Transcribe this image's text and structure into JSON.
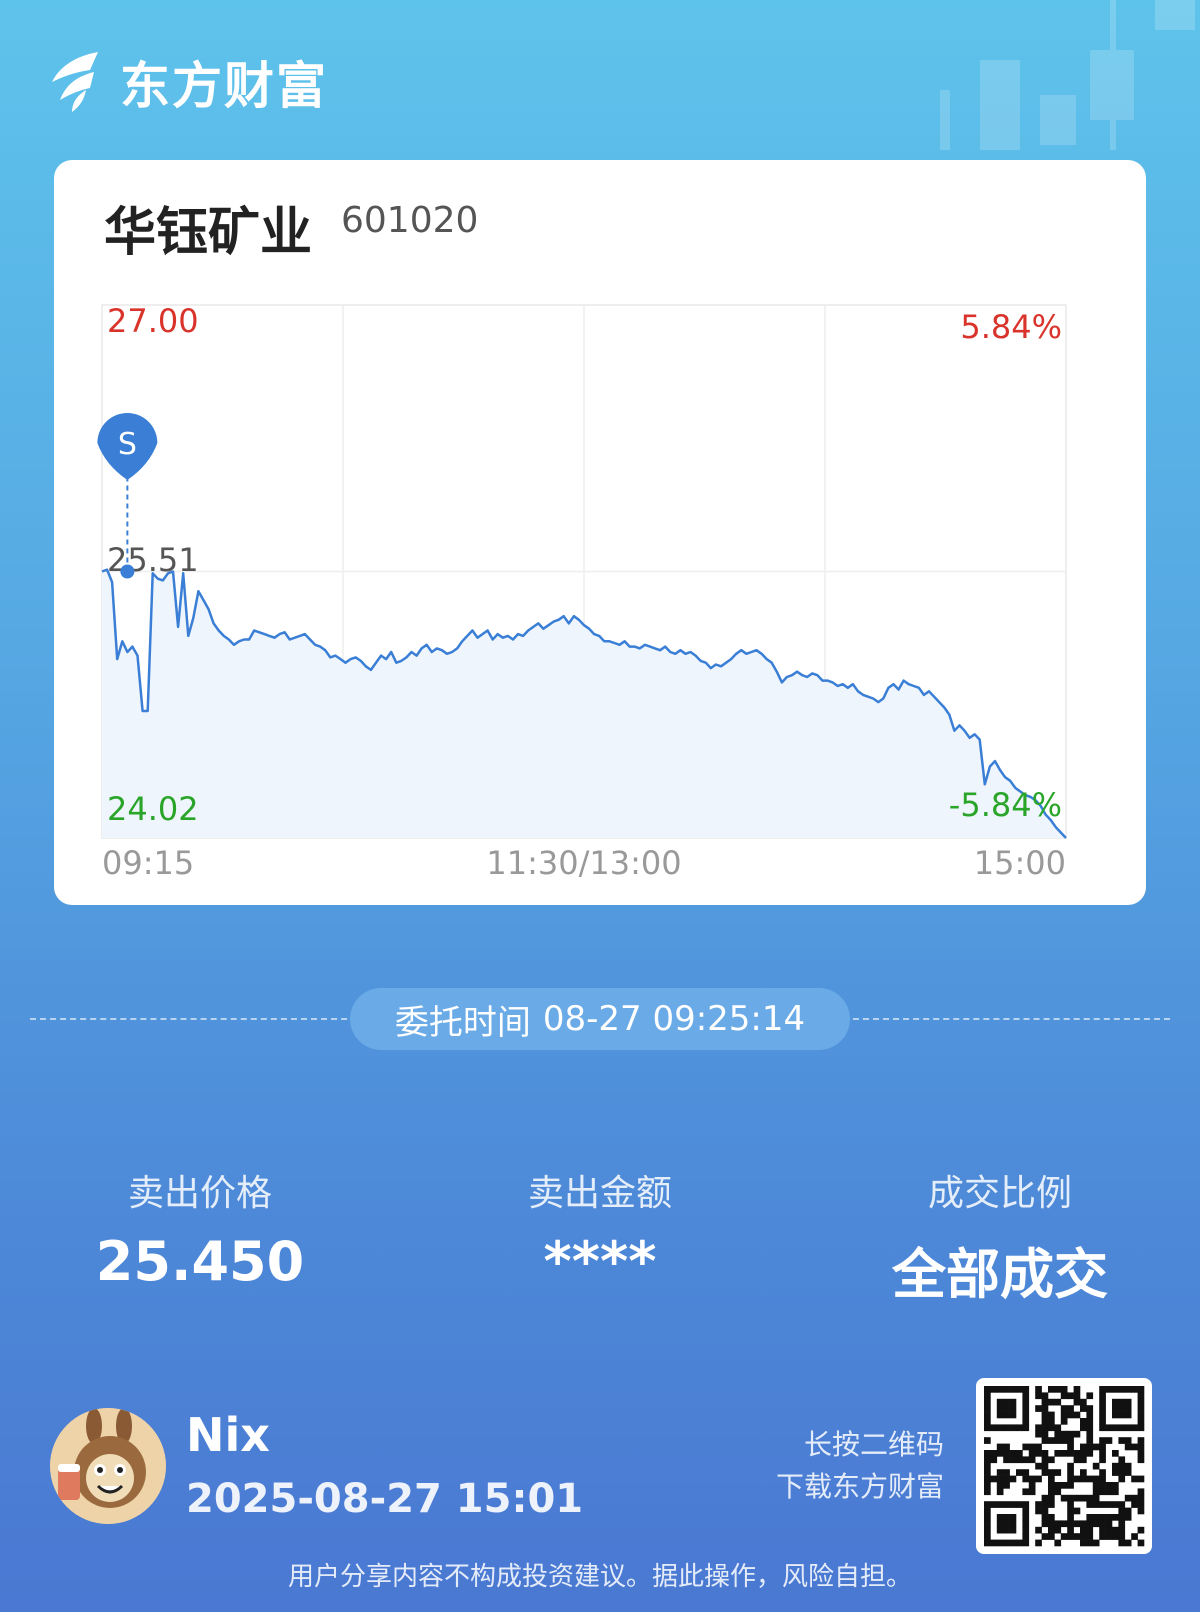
{
  "brand": {
    "name": "东方财富",
    "logo_icon": "eastmoney-logo-icon"
  },
  "stock": {
    "name": "华钰矿业",
    "code": "601020"
  },
  "chart_data": {
    "type": "line",
    "y_max_label": "27.00",
    "y_mid_label": "25.51",
    "y_min_label": "24.02",
    "pct_max_label": "5.84%",
    "pct_min_label": "-5.84%",
    "x_labels": [
      "09:15",
      "11:30/13:00",
      "15:00"
    ],
    "ylim": [
      24.02,
      27.0
    ],
    "reference_price": 25.51,
    "marker": {
      "label": "S",
      "x_index": 5,
      "price": 25.51
    },
    "colors": {
      "line": "#3a7fd5",
      "up": "#d9342b",
      "down": "#2aa52a",
      "fill": "#eef5fd"
    },
    "values": [
      25.51,
      25.52,
      25.45,
      25.02,
      25.12,
      25.06,
      25.09,
      25.04,
      24.73,
      24.73,
      25.5,
      25.47,
      25.46,
      25.5,
      25.51,
      25.2,
      25.5,
      25.15,
      25.25,
      25.4,
      25.35,
      25.3,
      25.22,
      25.18,
      25.15,
      25.13,
      25.1,
      25.12,
      25.13,
      25.13,
      25.18,
      25.17,
      25.16,
      25.15,
      25.14,
      25.16,
      25.17,
      25.13,
      25.14,
      25.15,
      25.16,
      25.13,
      25.1,
      25.09,
      25.07,
      25.03,
      25.04,
      25.02,
      25.0,
      25.02,
      25.03,
      25.01,
      24.98,
      24.96,
      25.0,
      25.04,
      25.02,
      25.06,
      25.0,
      25.01,
      25.03,
      25.06,
      25.04,
      25.08,
      25.1,
      25.06,
      25.08,
      25.07,
      25.05,
      25.06,
      25.08,
      25.12,
      25.15,
      25.18,
      25.14,
      25.16,
      25.18,
      25.13,
      25.16,
      25.14,
      25.15,
      25.13,
      25.16,
      25.15,
      25.18,
      25.2,
      25.22,
      25.19,
      25.21,
      25.23,
      25.24,
      25.26,
      25.22,
      25.26,
      25.24,
      25.21,
      25.19,
      25.16,
      25.15,
      25.12,
      25.12,
      25.11,
      25.1,
      25.12,
      25.09,
      25.09,
      25.08,
      25.1,
      25.09,
      25.08,
      25.07,
      25.09,
      25.06,
      25.05,
      25.07,
      25.05,
      25.06,
      25.04,
      25.01,
      25.0,
      24.97,
      24.99,
      24.98,
      25.0,
      25.02,
      25.05,
      25.07,
      25.05,
      25.06,
      25.07,
      25.05,
      25.02,
      25.0,
      24.95,
      24.89,
      24.92,
      24.93,
      24.95,
      24.93,
      24.92,
      24.94,
      24.93,
      24.9,
      24.9,
      24.89,
      24.87,
      24.88,
      24.86,
      24.88,
      24.84,
      24.82,
      24.81,
      24.8,
      24.78,
      24.8,
      24.86,
      24.88,
      24.85,
      24.9,
      24.88,
      24.87,
      24.86,
      24.82,
      24.84,
      24.81,
      24.78,
      24.75,
      24.71,
      24.62,
      24.65,
      24.62,
      24.58,
      24.6,
      24.57,
      24.32,
      24.42,
      24.45,
      24.4,
      24.36,
      24.34,
      24.3,
      24.28,
      24.26,
      24.25,
      24.23,
      24.2,
      24.15,
      24.12,
      24.08,
      24.05,
      24.02
    ]
  },
  "order_time": {
    "label": "委托时间",
    "value": "08-27 09:25:14"
  },
  "stats": [
    {
      "label": "卖出价格",
      "value": "25.450"
    },
    {
      "label": "卖出金额",
      "value": "****"
    },
    {
      "label": "成交比例",
      "value": "全部成交"
    }
  ],
  "user": {
    "name": "Nix",
    "timestamp": "2025-08-27 15:01",
    "avatar_icon": "avatar-icon"
  },
  "qr": {
    "line1": "长按二维码",
    "line2": "下载东方财富",
    "icon": "qr-code-icon"
  },
  "disclaimer": "用户分享内容不构成投资建议。据此操作，风险自担。"
}
